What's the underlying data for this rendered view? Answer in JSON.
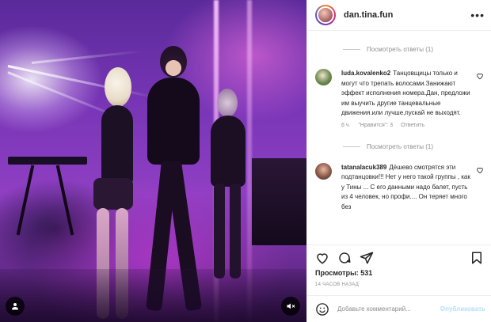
{
  "header": {
    "username": "dan.tina.fun",
    "more_icon": "more-horizontal-icon"
  },
  "comments": {
    "view_replies_top": "Посмотреть ответы (1)",
    "items": [
      {
        "author": "luda.kovalenko2",
        "text": "Танцовщицы только и могут что трепать волосами.Занижают эффект исполнения номера.Дан, предложи им выучить другие танцевальные движения.или лучше,пускай не выходят.",
        "time": "6 ч.",
        "likes": "\"Нравится\": 3",
        "reply": "Ответить",
        "view_replies": "Посмотреть ответы (1)"
      },
      {
        "author": "tatanalacuk389",
        "text": "Дёшево смотрятся эти подтанцовки!!! Нет у него такой группы , как у Тины ... С его данными надо балет, пусть из 4 человек, но профи.... Он теряет много без"
      }
    ]
  },
  "stats": {
    "views": "Просмотры: 531",
    "timestamp": "14 ЧАСОВ НАЗАД"
  },
  "composer": {
    "placeholder": "Добавьте комментарий...",
    "publish": "Опубликовать"
  },
  "colors": {
    "accent_disabled": "#b2dffc",
    "muted": "#8e8e8e",
    "text": "#262626"
  }
}
